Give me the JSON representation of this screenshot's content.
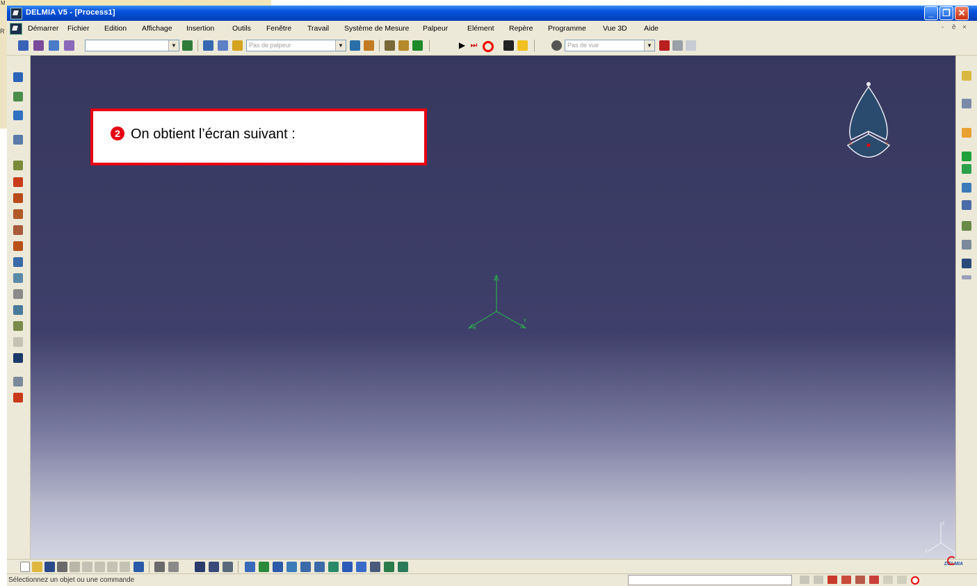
{
  "background_window": {
    "top_text": "M",
    "side_text": "R"
  },
  "window": {
    "title": "DELMIA V5 - [Process1]",
    "controls": {
      "minimize": "_",
      "maximize": "❐",
      "close": "✕"
    }
  },
  "menubar": {
    "items": [
      "Démarrer",
      "Fichier",
      "Edition",
      "Affichage",
      "Insertion",
      "Outils",
      "Fenêtre",
      "Travail",
      "Système de Mesure",
      "Palpeur",
      "Elément",
      "Repère",
      "Programme",
      "Vue 3D",
      "Aide"
    ],
    "mdi_controls": [
      "-",
      "ē",
      "×"
    ]
  },
  "toolbar": {
    "combo_1": "",
    "combo_palpeur": "Pas de palpeur",
    "combo_vue": "Pas de vue"
  },
  "viewport": {
    "annotation": {
      "number": "2",
      "text": "On obtient l’écran suivant :"
    },
    "axes": {
      "x": "X",
      "y": "Y",
      "z": "Z"
    }
  },
  "status_bar": {
    "message": "Sélectionnez un objet ou une commande",
    "input_value": ""
  },
  "brand": {
    "logo_text": "DELMIA"
  },
  "colors": {
    "annotation_border": "#e60012",
    "viewport_top": "#37385f",
    "viewport_bottom": "#d4d5e2",
    "axis_green": "#2fa84f",
    "compass_fill": "#2a4a6e"
  }
}
